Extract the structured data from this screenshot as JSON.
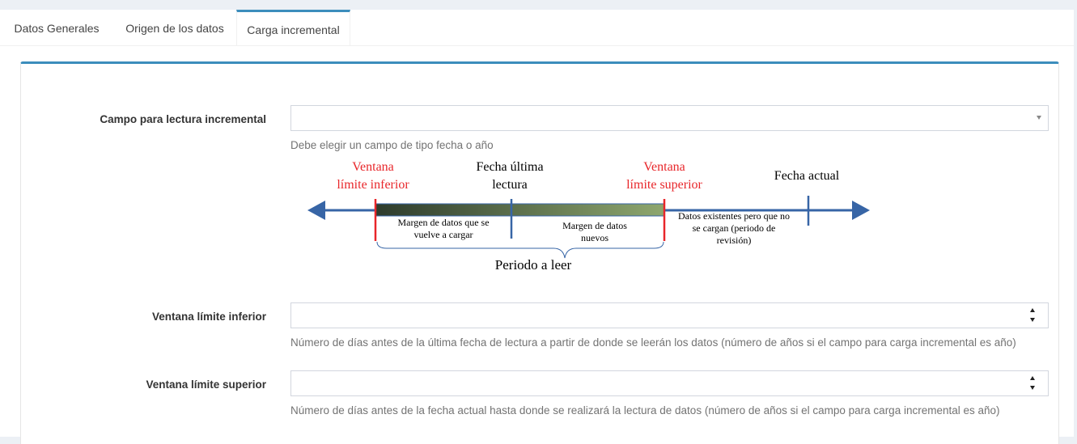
{
  "tabs": [
    "Datos Generales",
    "Origen de los datos",
    "Carga incremental"
  ],
  "form": {
    "campo_label": "Campo para lectura incremental",
    "campo_value": "",
    "campo_help": "Debe elegir un campo de tipo fecha o año",
    "ventana_inferior_label": "Ventana límite inferior",
    "ventana_inferior_value": "",
    "ventana_inferior_help": "Número de días antes de la última fecha de lectura a partir de donde se leerán los datos (número de años si el campo para carga incremental es año)",
    "ventana_superior_label": "Ventana límite superior",
    "ventana_superior_value": "",
    "ventana_superior_help": "Número de días antes de la fecha actual hasta donde se realizará la lectura de datos (número de años si el campo para carga incremental es año)"
  },
  "diagram": {
    "ventana_inferior_line1": "Ventana",
    "ventana_inferior_line2": "límite inferior",
    "fecha_ultima_line1": "Fecha última",
    "fecha_ultima_line2": "lectura",
    "ventana_superior_line1": "Ventana",
    "ventana_superior_line2": "límite superior",
    "fecha_actual": "Fecha actual",
    "margen_recarga_line1": "Margen de datos que se",
    "margen_recarga_line2": "vuelve a cargar",
    "margen_nuevos_line1": "Margen de datos",
    "margen_nuevos_line2": "nuevos",
    "existentes_line1": "Datos existentes pero que no",
    "existentes_line2": "se cargan (periodo de",
    "existentes_line3": "revisión)",
    "periodo": "Periodo a leer",
    "colors": {
      "accent_red": "#e8262a",
      "axis_blue": "#3765a6",
      "bar_dark": "#2d3b2c",
      "bar_light": "#8ea76e"
    }
  }
}
